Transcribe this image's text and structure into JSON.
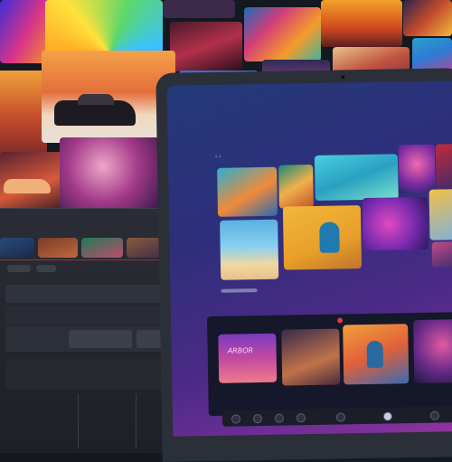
{
  "colors": {
    "background": "#141820",
    "laptop_body": "#2b2f38",
    "screen_gradient_start": "#243a77",
    "screen_gradient_end": "#93349c",
    "accent_red": "#e03a4a"
  },
  "editor": {
    "items": [
      "",
      "",
      "",
      "",
      ""
    ],
    "icons": [
      "play-icon",
      "pause-icon",
      "scrub-handle-icon"
    ]
  },
  "laptop": {
    "gallery_captions": [
      "",
      ""
    ],
    "poster_text": "ARBOR",
    "dock_icons": [
      "home-icon",
      "search-icon",
      "camera-icon",
      "settings-icon",
      "close-icon",
      "heart-icon",
      "profile-icon"
    ]
  }
}
